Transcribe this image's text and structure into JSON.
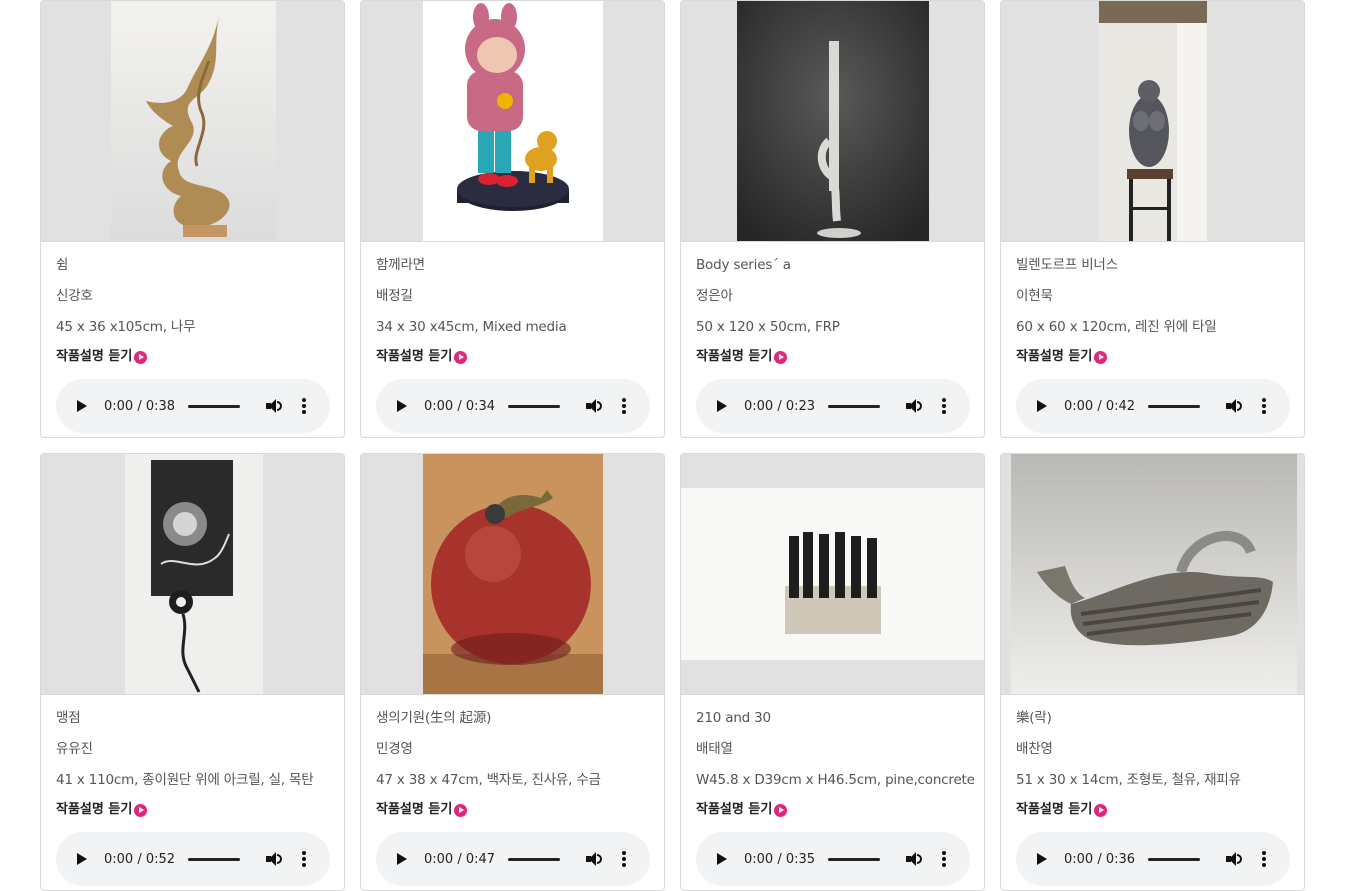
{
  "listen_label": "작품설명 듣기",
  "artworks": [
    {
      "title": "쉼",
      "artist": "신강호",
      "spec": "45 x 36 x105cm, 나무",
      "audio_time": "0:00 / 0:38",
      "image": "driftwood-sculpture"
    },
    {
      "title": "함께라면",
      "artist": "배정길",
      "spec": "34 x 30 x45cm, Mixed media",
      "audio_time": "0:00 / 0:34",
      "image": "girl-and-dog-figure"
    },
    {
      "title": "Body series´ a",
      "artist": "정은아",
      "spec": "50 x 120 x 50cm, FRP",
      "audio_time": "0:00 / 0:23",
      "image": "white-leg-sculpture"
    },
    {
      "title": "빌렌도르프 비너스",
      "artist": "이현묵",
      "spec": "60 x 60 x 120cm, 레진 위에 타일",
      "audio_time": "0:00 / 0:42",
      "image": "venus-figure-on-pedestal"
    },
    {
      "title": "맹점",
      "artist": "유유진",
      "spec": "41 x 110cm, 종이원단 위에 아크릴, 실, 목탄",
      "audio_time": "0:00 / 0:52",
      "image": "hanging-drawing"
    },
    {
      "title": "생의기원(生의 起源)",
      "artist": "민경영",
      "spec": "47 x 38 x 47cm, 백자토, 진사유, 수금",
      "audio_time": "0:00 / 0:47",
      "image": "red-ceramic-sphere"
    },
    {
      "title": "210 and 30",
      "artist": "배태열",
      "spec": "W45.8 x D39cm x H46.5cm, pine,concrete",
      "audio_time": "0:00 / 0:35",
      "image": "pine-concrete-block"
    },
    {
      "title": "樂(락)",
      "artist": "배찬영",
      "spec": "51 x 30 x 14cm, 조형토, 철유, 재피유",
      "audio_time": "0:00 / 0:36",
      "image": "ceramic-teapot"
    }
  ]
}
